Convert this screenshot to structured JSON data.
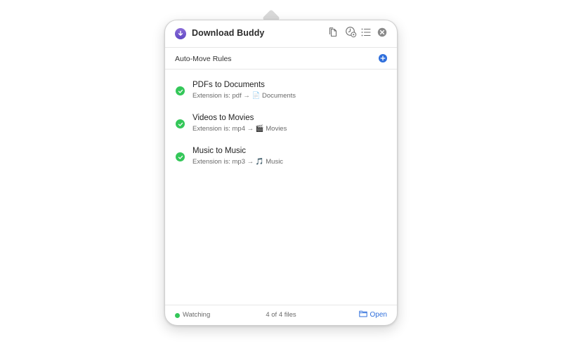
{
  "header": {
    "title": "Download Buddy",
    "icons": [
      "download-icon",
      "copy-files-icon",
      "clock-settings-icon",
      "list-icon",
      "close-icon"
    ]
  },
  "section": {
    "title": "Auto-Move Rules",
    "add_icon": "plus-circle-icon"
  },
  "rules": [
    {
      "name": "PDFs to Documents",
      "condition": "Extension is: pdf",
      "arrow": "→",
      "dest_icon": "📄",
      "destination": "Documents",
      "enabled": true
    },
    {
      "name": "Videos to Movies",
      "condition": "Extension is: mp4",
      "arrow": "→",
      "dest_icon": "🎬",
      "destination": "Movies",
      "enabled": true
    },
    {
      "name": "Music to Music",
      "condition": "Extension is: mp3",
      "arrow": "→",
      "dest_icon": "🎵",
      "destination": "Music",
      "enabled": true
    }
  ],
  "footer": {
    "status": "Watching",
    "file_count": "4 of 4 files",
    "open_label": "Open"
  },
  "colors": {
    "accent": "#2f6fdc",
    "success": "#34c759",
    "app_icon": "#6a52c8"
  }
}
